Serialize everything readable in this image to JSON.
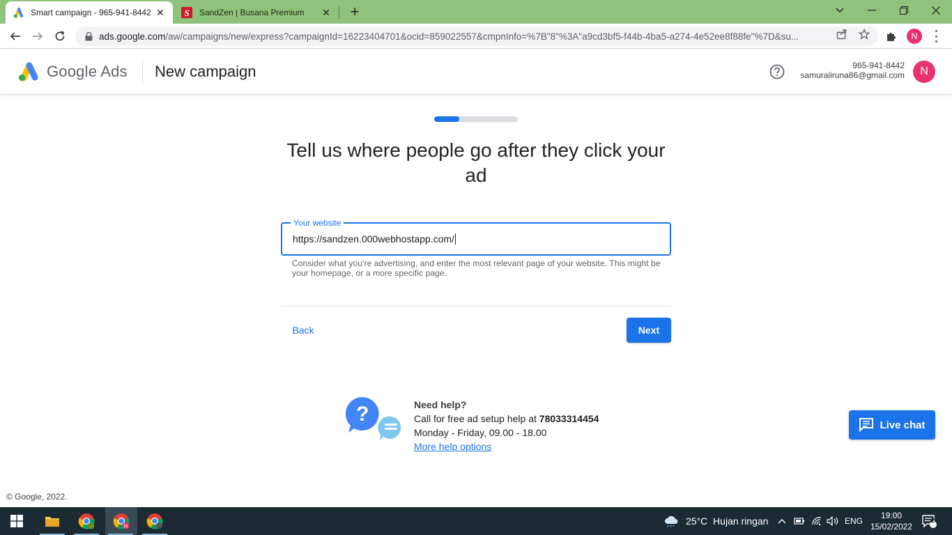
{
  "browser": {
    "tabs": [
      {
        "title": "Smart campaign - 965-941-8442",
        "active": true
      },
      {
        "title": "SandZen | Busana Premium",
        "active": false
      }
    ],
    "url_main": "ads.google.com",
    "url_rest": "/aw/campaigns/new/express?campaignId=16223404701&ocid=859022557&cmpnInfo=%7B\"8\"%3A\"a9cd3bf5-f44b-4ba5-a274-4e52ee8f88fe\"%7D&su...",
    "profile_initial": "N"
  },
  "header": {
    "brand_google": "Google",
    "brand_ads": "Ads",
    "title": "New campaign",
    "account_id": "965-941-8442",
    "account_email": "samuraiiruna86@gmail.com",
    "avatar_initial": "N"
  },
  "wizard": {
    "progress_fraction": 0.3,
    "headline": "Tell us where people go after they click your ad",
    "field_label": "Your website",
    "field_value": "https://sandzen.000webhostapp.com/",
    "hint": "Consider what you're advertising, and enter the most relevant page of your website. This might be your homepage, or a more specific page.",
    "back_label": "Back",
    "next_label": "Next"
  },
  "help": {
    "title": "Need help?",
    "call_prefix": "Call for free ad setup help at ",
    "phone": "78033314454",
    "hours": "Monday - Friday, 09.00 - 18.00",
    "more_link": "More help options"
  },
  "livechat_label": "Live chat",
  "footer": "© Google, 2022.",
  "taskbar": {
    "weather": "25°C  Hujan ringan",
    "language": "ENG",
    "time": "19:00",
    "date": "15/02/2022",
    "notifications": "2"
  },
  "colors": {
    "accent": "#1a73e8",
    "tabstrip": "#8fc27b",
    "avatar": "#e8336f",
    "taskbar": "#1b2a33"
  }
}
